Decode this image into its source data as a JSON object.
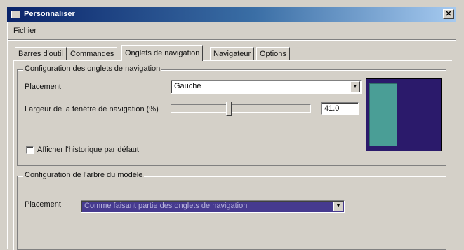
{
  "window": {
    "title": "Personnaliser",
    "close_glyph": "✕"
  },
  "menu": {
    "items": [
      {
        "label": "Fichier"
      }
    ]
  },
  "tabs": [
    {
      "label": "Barres d'outil"
    },
    {
      "label": "Commandes"
    },
    {
      "label": "Onglets de navigation"
    },
    {
      "label": "Navigateur"
    },
    {
      "label": "Options"
    }
  ],
  "nav_group": {
    "title": "Configuration des onglets de navigation",
    "placement_label": "Placement",
    "placement_value": "Gauche",
    "width_label": "Largeur de la fenêtre de navigation (%)",
    "width_value": "41.0",
    "slider_fraction": 0.41,
    "history_label": "Afficher l'historique par défaut",
    "history_checked": false
  },
  "tree_group": {
    "title": "Configuration de l'arbre du modèle",
    "placement_label": "Placement",
    "placement_value": "Comme faisant partie des onglets de navigation"
  },
  "colors": {
    "preview_bg": "#2b1a6b",
    "preview_panel": "#4a9e96",
    "title_start": "#0a246a"
  }
}
